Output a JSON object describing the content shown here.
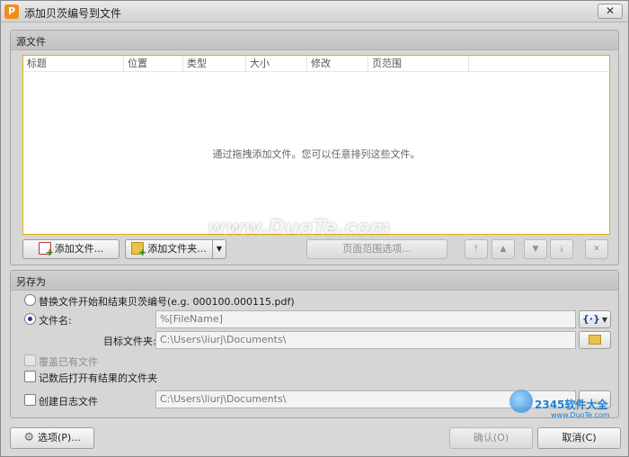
{
  "window": {
    "title": "添加贝茨编号到文件",
    "close_label": "✕",
    "app_icon_letter": "P"
  },
  "source_group": {
    "title": "源文件",
    "columns": [
      "标题",
      "位置",
      "类型",
      "大小",
      "修改",
      "页范围"
    ],
    "empty_message": "通过拖拽添加文件。您可以任意排列这些文件。",
    "buttons": {
      "add_file": "添加文件...",
      "add_folder": "添加文件夹...",
      "page_range": "页面范围选项..."
    }
  },
  "save_as_group": {
    "title": "另存为",
    "replace_radio": "替换文件开始和结束贝茨编号(e.g. 000100.000115.pdf)",
    "filename_radio": "文件名:",
    "filename_value": "%[FileName]",
    "target_folder_label": "目标文件夹:",
    "target_folder_value": "C:\\Users\\liurj\\Documents\\",
    "overwrite_label": "覆盖已有文件",
    "open_folder_label": "记数后打开有结果的文件夹",
    "log_label": "创建日志文件",
    "log_path_value": "C:\\Users\\liurj\\Documents\\"
  },
  "footer": {
    "options_label": "选项(P)...",
    "ok_label": "确认(O)",
    "cancel_label": "取消(C)"
  },
  "watermarks": {
    "main": "www.DuoTe.com",
    "corner": "2345软件大全",
    "corner_url": "www.DuoTe.com"
  }
}
